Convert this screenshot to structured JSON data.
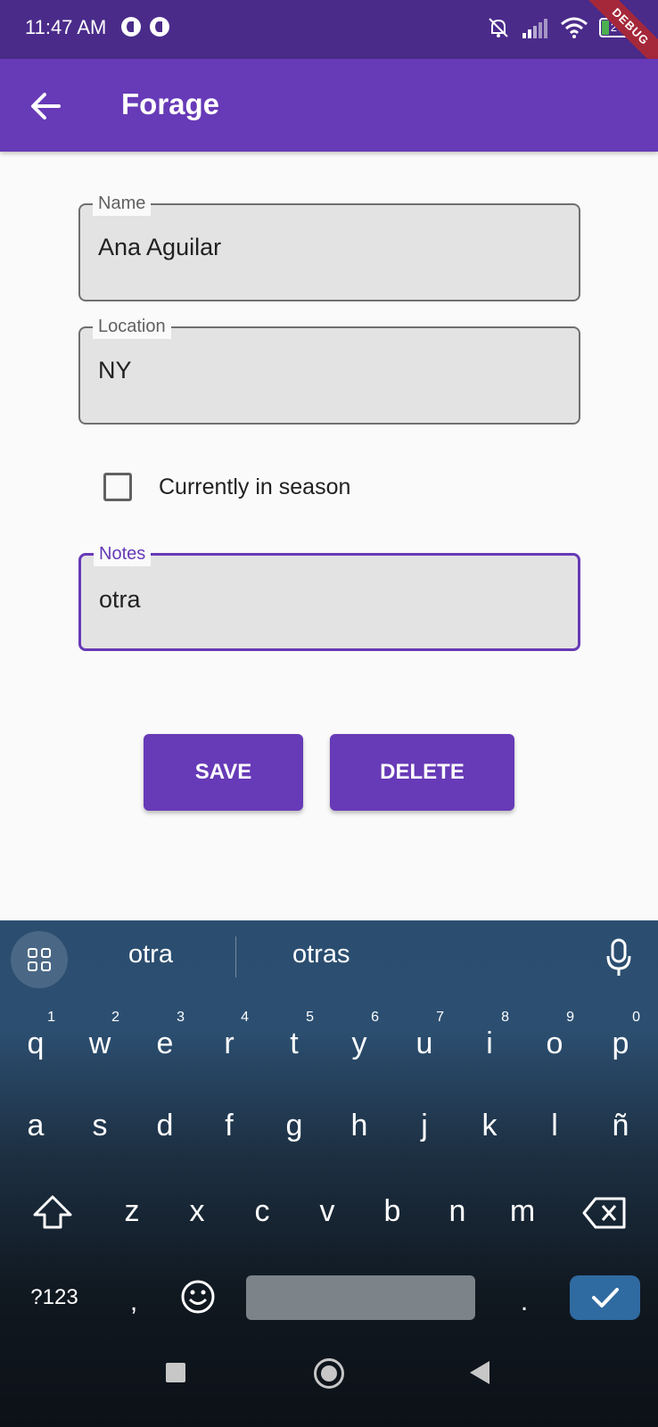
{
  "status_bar": {
    "time": "11:47 AM",
    "battery": "27",
    "debug_banner": "DEBUG"
  },
  "app_bar": {
    "title": "Forage",
    "back_icon": "arrow-back-icon",
    "color": "#673ab7"
  },
  "form": {
    "name": {
      "label": "Name",
      "value": "Ana Aguilar"
    },
    "location": {
      "label": "Location",
      "value": "NY"
    },
    "in_season": {
      "label": "Currently in season",
      "checked": false
    },
    "notes": {
      "label": "Notes",
      "value": "otra",
      "focused": true
    }
  },
  "actions": {
    "save_label": "SAVE",
    "delete_label": "DELETE"
  },
  "keyboard": {
    "suggestions": [
      "otra",
      "otras"
    ],
    "row1": [
      {
        "key": "q",
        "hint": "1"
      },
      {
        "key": "w",
        "hint": "2"
      },
      {
        "key": "e",
        "hint": "3"
      },
      {
        "key": "r",
        "hint": "4"
      },
      {
        "key": "t",
        "hint": "5"
      },
      {
        "key": "y",
        "hint": "6"
      },
      {
        "key": "u",
        "hint": "7"
      },
      {
        "key": "i",
        "hint": "8"
      },
      {
        "key": "o",
        "hint": "9"
      },
      {
        "key": "p",
        "hint": "0"
      }
    ],
    "row2": [
      "a",
      "s",
      "d",
      "f",
      "g",
      "h",
      "j",
      "k",
      "l",
      "ñ"
    ],
    "row3": [
      "z",
      "x",
      "c",
      "v",
      "b",
      "n",
      "m"
    ],
    "symbols_key": "?123",
    "comma_key": ",",
    "period_key": ".",
    "accent_color": "#2f6aa1"
  }
}
